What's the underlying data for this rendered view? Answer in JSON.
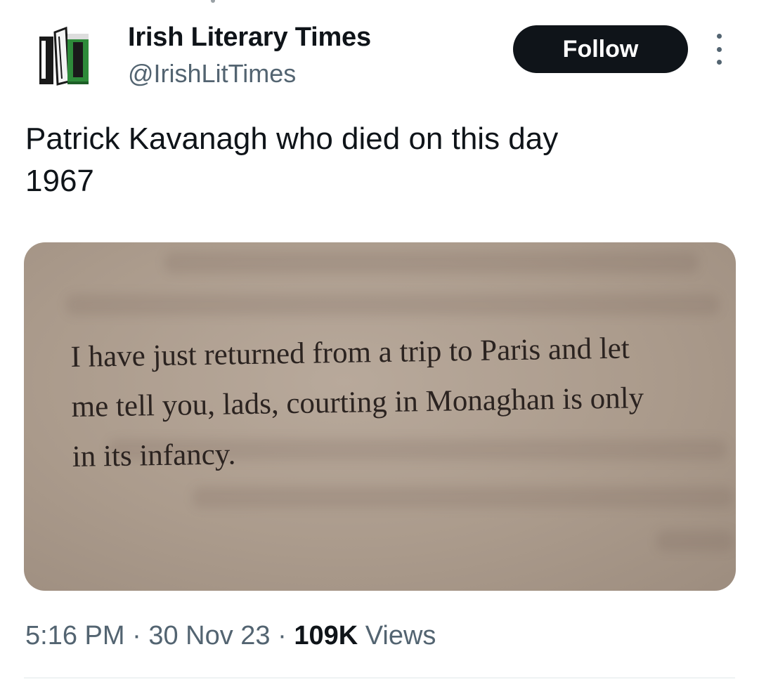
{
  "account": {
    "display_name": "Irish Literary Times",
    "handle": "@IrishLitTimes",
    "avatar_icon": "books-logo-icon"
  },
  "actions": {
    "follow_label": "Follow",
    "more_icon": "more-options-icon"
  },
  "tweet": {
    "text_line1": "Patrick Kavanagh who died on this day",
    "text_line2": "1967"
  },
  "media": {
    "quote_lines": [
      "I have just returned from a trip to Paris and let",
      "me tell you, lads, courting in Monaghan is only",
      "in its infancy."
    ]
  },
  "meta": {
    "time": "5:16 PM",
    "separator": "·",
    "date": "30 Nov 23",
    "views_count": "109K",
    "views_label": "Views"
  },
  "colors": {
    "text_primary": "#0f1419",
    "text_secondary": "#536471",
    "follow_bg": "#0f1419",
    "logo_green": "#2e8b3a",
    "divider": "#eff3f4"
  }
}
